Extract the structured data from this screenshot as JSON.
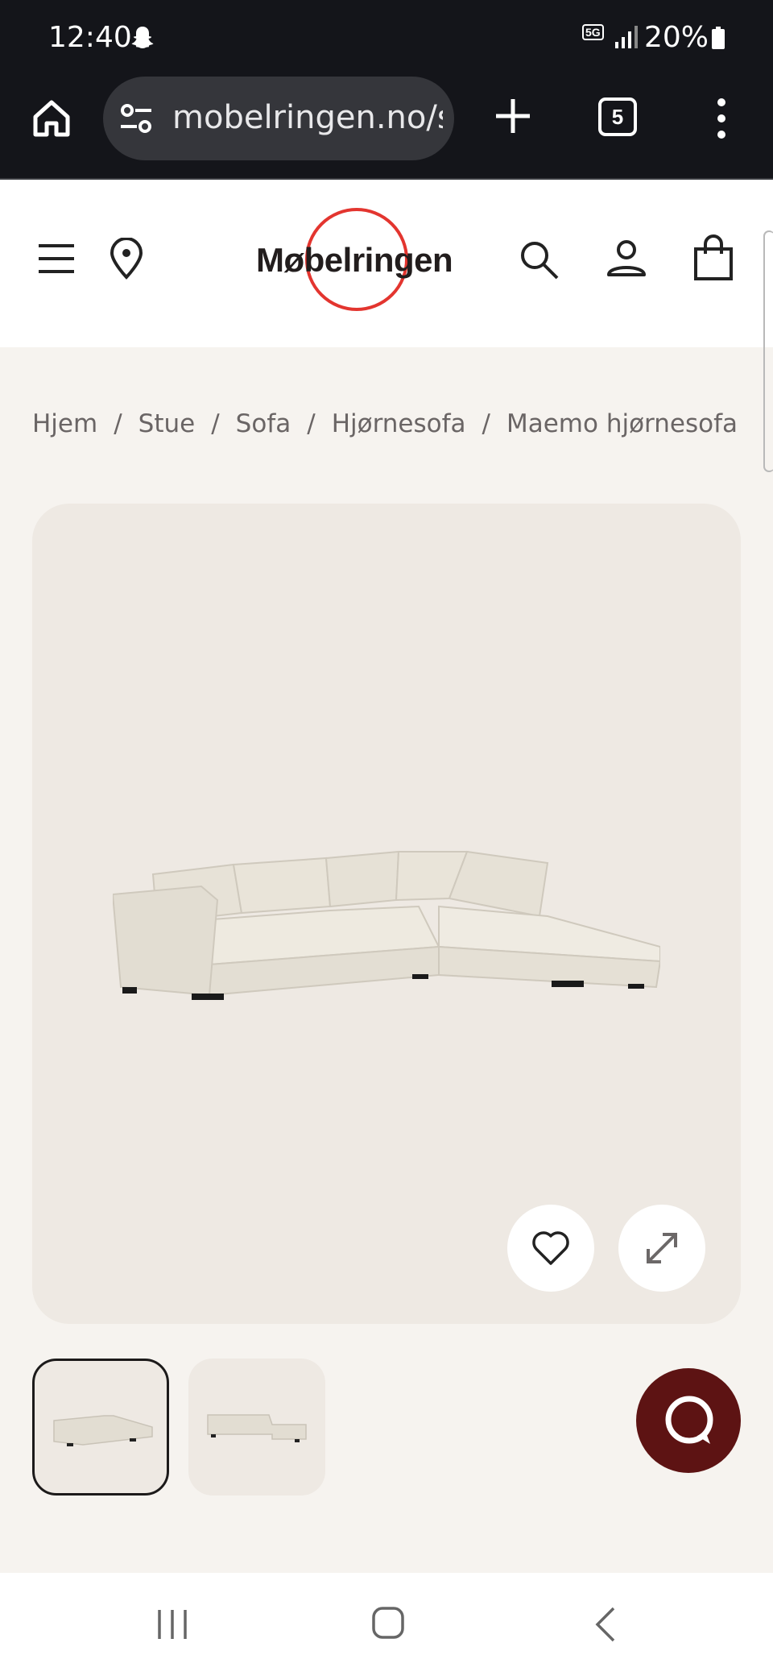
{
  "status_bar": {
    "time": "12:40",
    "network": "5G",
    "battery": "20%"
  },
  "browser": {
    "url": "mobelringen.no/s",
    "tab_count": "5"
  },
  "site": {
    "logo_text": "Møbelringen",
    "brand_color": "#e3352f"
  },
  "breadcrumb": {
    "items": [
      "Hjem",
      "Stue",
      "Sofa",
      "Hjørnesofa",
      "Maemo hjørnesofa"
    ]
  },
  "product": {
    "image_alt": "Maemo hjørnesofa",
    "thumbnail_count": 2,
    "selected_thumbnail": 1
  },
  "icons": {
    "status": [
      "snapchat-icon",
      "signal-icon",
      "battery-icon"
    ],
    "browser": [
      "home-icon",
      "site-settings-icon",
      "new-tab-icon",
      "tab-switcher-icon",
      "more-icon"
    ],
    "header": [
      "menu-icon",
      "location-pin-icon",
      "search-icon",
      "user-icon",
      "cart-bag-icon"
    ],
    "product": [
      "heart-icon",
      "expand-icon",
      "chat-icon"
    ],
    "system_nav": [
      "recent-apps-icon",
      "home-button-icon",
      "back-icon"
    ]
  },
  "colors": {
    "page_bg": "#f6f3ef",
    "card_bg": "#eee9e3",
    "chat_bg": "#5d1313"
  }
}
